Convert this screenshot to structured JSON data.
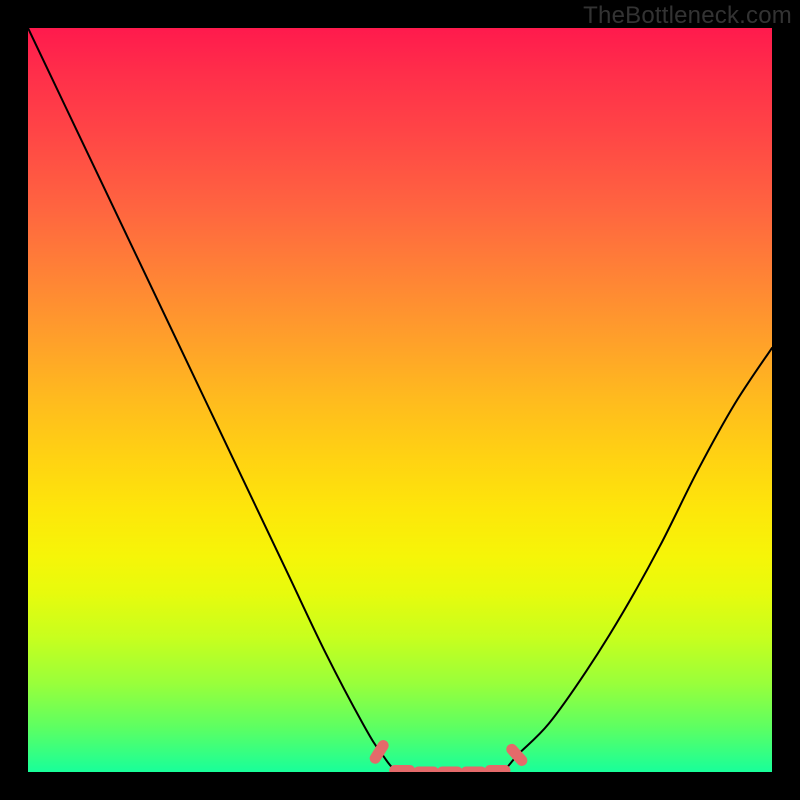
{
  "watermark": "TheBottleneck.com",
  "colors": {
    "page_bg": "#000000",
    "curve_stroke": "#000000",
    "pill_fill": "#e46a6a",
    "gradient_top": "#ff1a4d",
    "gradient_bottom": "#18ff9a"
  },
  "chart_data": {
    "type": "line",
    "title": "",
    "xlabel": "",
    "ylabel": "",
    "x": [
      0.0,
      0.05,
      0.1,
      0.15,
      0.2,
      0.25,
      0.3,
      0.35,
      0.4,
      0.45,
      0.475,
      0.5,
      0.55,
      0.6,
      0.635,
      0.66,
      0.7,
      0.75,
      0.8,
      0.85,
      0.9,
      0.95,
      1.0
    ],
    "values": [
      1.0,
      0.895,
      0.79,
      0.685,
      0.58,
      0.475,
      0.37,
      0.265,
      0.16,
      0.065,
      0.025,
      0.0,
      0.0,
      0.0,
      0.0,
      0.025,
      0.065,
      0.135,
      0.215,
      0.305,
      0.405,
      0.495,
      0.57
    ],
    "xlim": [
      0,
      1
    ],
    "ylim": [
      0,
      1
    ],
    "flat_region": {
      "x_start": 0.5,
      "x_end": 0.635,
      "y": 0.0
    },
    "pills": [
      {
        "cx": 0.472,
        "cy": 0.027,
        "angle_deg": -58
      },
      {
        "cx": 0.503,
        "cy": 0.002,
        "angle_deg": 0
      },
      {
        "cx": 0.535,
        "cy": 0.0,
        "angle_deg": 0
      },
      {
        "cx": 0.567,
        "cy": 0.0,
        "angle_deg": 0
      },
      {
        "cx": 0.599,
        "cy": 0.0,
        "angle_deg": 0
      },
      {
        "cx": 0.631,
        "cy": 0.002,
        "angle_deg": 0
      },
      {
        "cx": 0.657,
        "cy": 0.023,
        "angle_deg": 48
      }
    ]
  }
}
